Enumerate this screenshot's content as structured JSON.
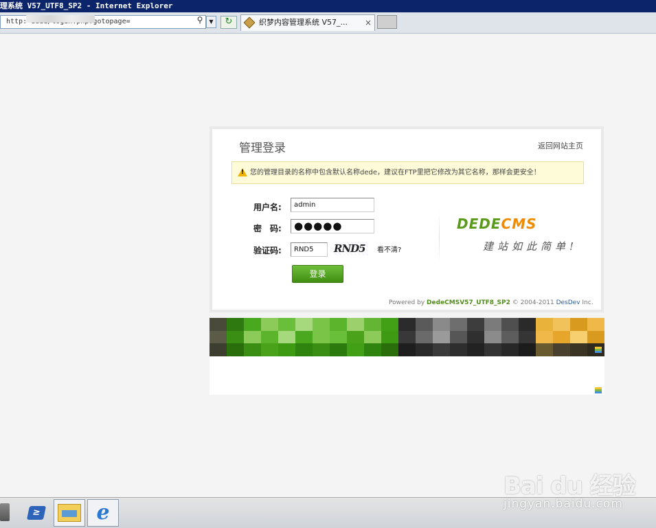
{
  "window": {
    "title": "理系统 V57_UTF8_SP2 - Internet Explorer"
  },
  "addressbar": {
    "url": "http:                       dede/login.php?gotopage=",
    "tab_label": "织梦内容管理系统 V57_...",
    "close_glyph": "×",
    "search_glyph": "⚲",
    "dropdown_glyph": "▼",
    "refresh_glyph": "↻"
  },
  "login": {
    "title": "管理登录",
    "back_link": "返回网站主页",
    "warning": "您的管理目录的名称中包含默认名称dede，建议在FTP里把它修改为其它名称，那样会更安全！",
    "warning_icon_glyph": "!",
    "username_label": "用户名:",
    "username_value": "admin",
    "password_label": "密　码:",
    "password_value": "●●●●●",
    "captcha_label": "验证码:",
    "captcha_value": "RND5",
    "captcha_image_text": "RND5",
    "captcha_refresh": "看不清?",
    "login_button": "登录",
    "logo_part1": "DEDE",
    "logo_part2": "CMS",
    "slogan": "建站如此简单!",
    "footer_prefix": "Powered by",
    "footer_version": "DedeCMSV57_UTF8_SP2",
    "footer_copyright": "© 2004-2011",
    "footer_company": "DesDev",
    "footer_suffix": "Inc."
  },
  "taskbar": {
    "ps_glyph": "≥",
    "ie_glyph": "e"
  },
  "watermark": {
    "brand": "Bai du 经验",
    "site": "jingyan.baidu.com"
  },
  "colors": {
    "accent_green": "#4f8e18",
    "logo_orange": "#f08a00",
    "titlebar_blue": "#0b246a"
  }
}
